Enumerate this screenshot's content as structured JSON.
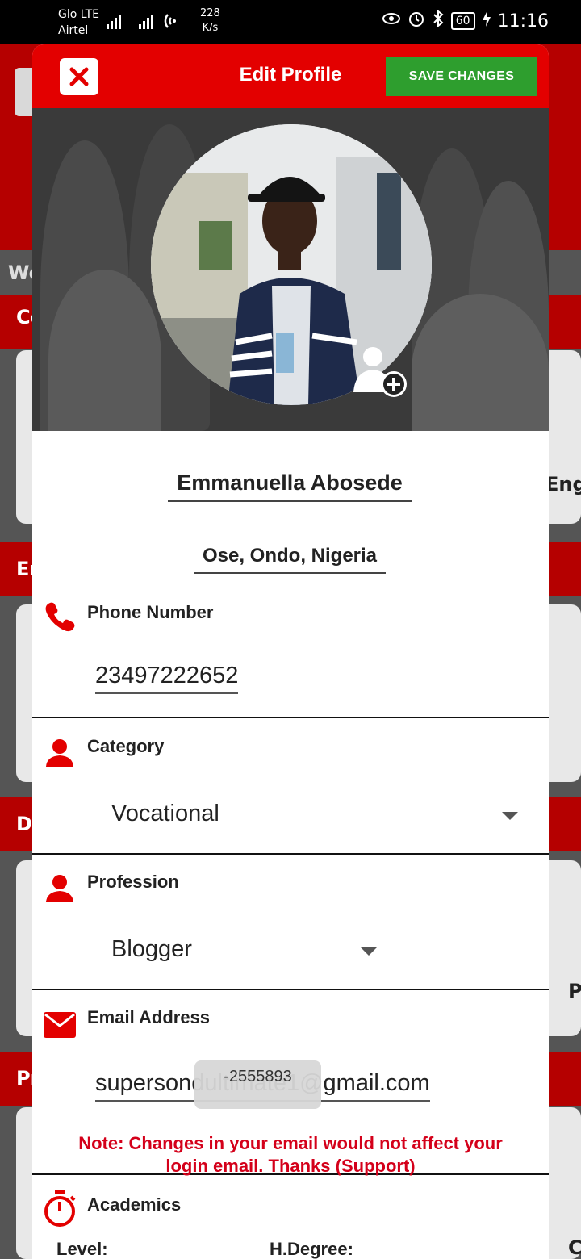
{
  "status_bar": {
    "carrier1": "Glo LTE",
    "carrier2": "Airtel",
    "speed_value": "228",
    "speed_unit": "K/s",
    "battery": "60",
    "time": "11:16"
  },
  "background": {
    "text_we": "We",
    "text_co": "Co",
    "text_en": "En",
    "text_d": "D",
    "text_pr": "Pr",
    "text_eng": "Eng",
    "text_p": "P",
    "text_c": "C"
  },
  "dialog": {
    "title": "Edit Profile",
    "save_label": "SAVE CHANGES",
    "name": "Emmanuella Abosede",
    "location": "Ose, Ondo, Nigeria",
    "phone": {
      "label": "Phone Number",
      "value": "23497222652"
    },
    "category": {
      "label": "Category",
      "selected": "Vocational"
    },
    "profession": {
      "label": "Profession",
      "selected": "Blogger"
    },
    "email": {
      "label": "Email Address",
      "value": "supersondultimate1@gmail.com"
    },
    "note_line1": "Note: Changes in your email would not affect your",
    "note_line2": "login email. Thanks (Support)",
    "academics": {
      "label": "Academics",
      "level_label": "Level:",
      "degree_label": "H.Degree:"
    }
  },
  "toast": "-2555893",
  "colors": {
    "header_red": "#e30000",
    "save_green": "#2e9e2e",
    "icon_red": "#e30000",
    "note_red": "#d4001a"
  }
}
